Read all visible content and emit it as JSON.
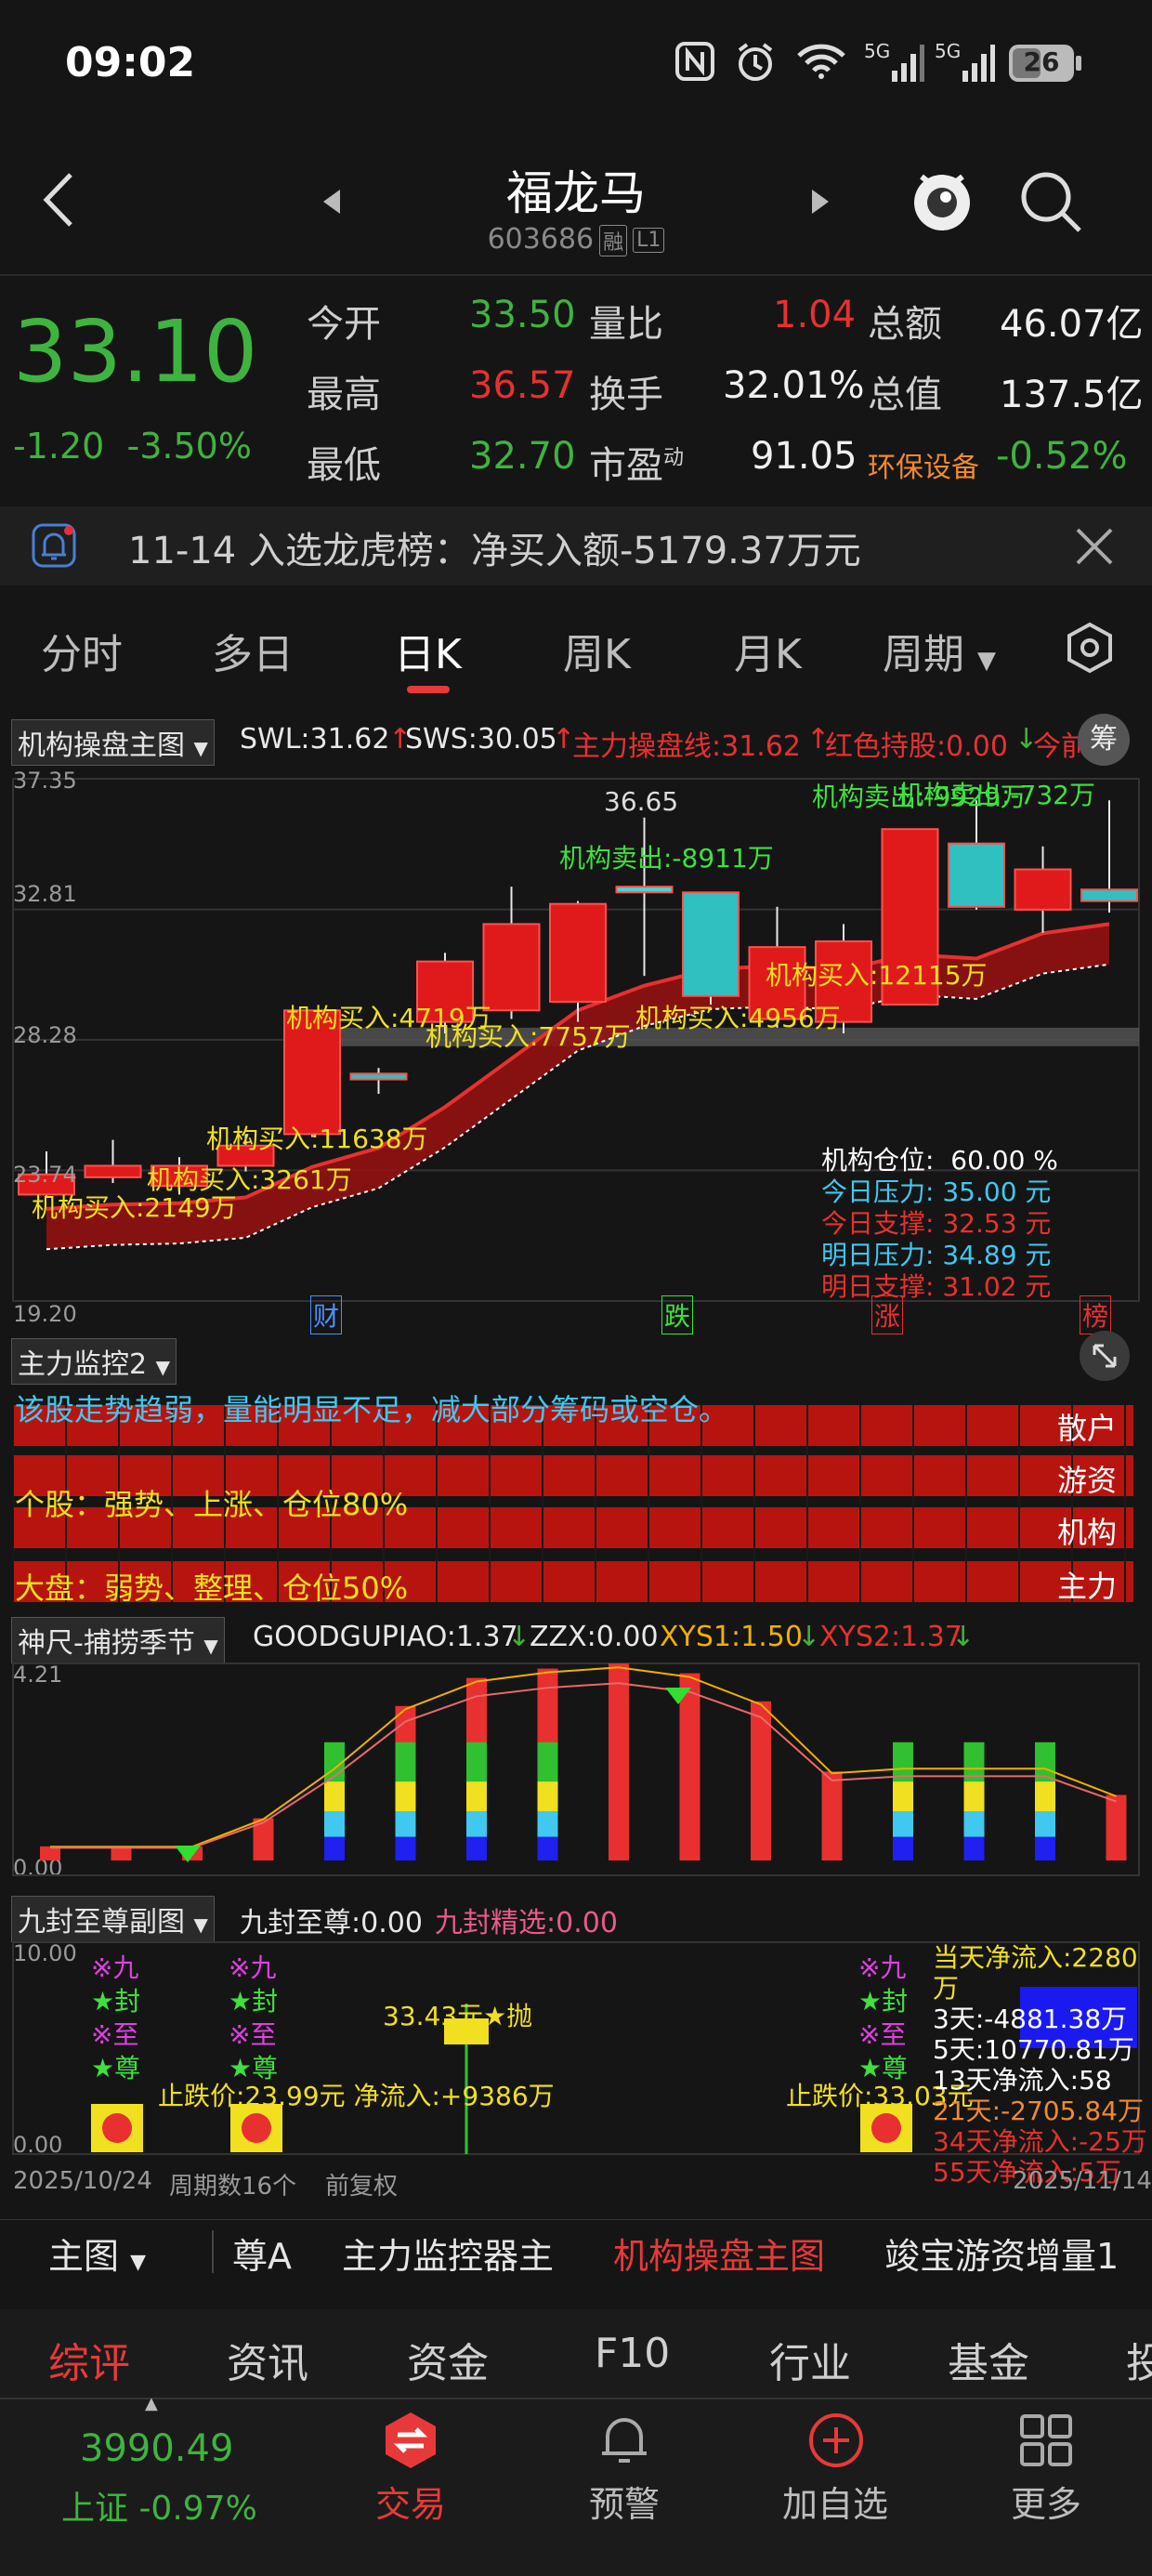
{
  "status_bar": {
    "time": "09:02",
    "battery": "26"
  },
  "header": {
    "name": "福龙马",
    "code": "603686",
    "tag1": "融",
    "tag2": "L1"
  },
  "quote": {
    "price": "33.10",
    "change": "-1.20",
    "change_pct": "-3.50%",
    "open_label": "今开",
    "open": "33.50",
    "high_label": "最高",
    "high": "36.57",
    "low_label": "最低",
    "low": "32.70",
    "vol_ratio_label": "量比",
    "vol_ratio": "1.04",
    "turnover_label": "换手",
    "turnover": "32.01%",
    "pe_label": "市盈",
    "pe_sup": "动",
    "pe": "91.05",
    "amount_label": "总额",
    "amount": "46.07亿",
    "mcap_label": "总值",
    "mcap": "137.5亿",
    "sector": "环保设备",
    "sector_pct": "-0.52%",
    "colors": {
      "up": "#e83030",
      "down": "#3fb33f"
    }
  },
  "notice": {
    "text": "11-14 入选龙虎榜：净买入额-5179.37万元"
  },
  "tabs": [
    "分时",
    "多日",
    "日K",
    "周K",
    "月K",
    "周期"
  ],
  "main_chart": {
    "label": "机构操盘主图",
    "ind1": "SWL:31.62",
    "ind2": "SWS:30.05",
    "ind3": "主力操盘线:31.62",
    "ind4": "红色持股:0.00",
    "ind5": "今前",
    "chip_btn": "筹",
    "y_labels": [
      "37.35",
      "32.81",
      "28.28",
      "23.74",
      "19.20"
    ],
    "high_label": "36.65",
    "annotations": [
      "机构卖出:-8911万",
      "机构卖出:-9929万",
      "机构卖出:-732万",
      "机构买入:4719万",
      "机构买入:7757万",
      "机构买入:4956万",
      "机构买入:12115万",
      "机构买入:11638万",
      "机构买入:3261万",
      "机构买入:2149万"
    ],
    "info": {
      "pos_label": "机构仓位:",
      "pos": "60.00 %",
      "press1_label": "今日压力:",
      "press1": "35.00 元",
      "supp1_label": "今日支撑:",
      "supp1": "32.53 元",
      "press2_label": "明日压力:",
      "press2": "34.89 元",
      "supp2_label": "明日支撑:",
      "supp2": "31.02 元"
    },
    "markers": [
      "财",
      "跌",
      "涨",
      "榜"
    ]
  },
  "chart_data": {
    "type": "candlestick",
    "ylim": [
      19.2,
      37.35
    ],
    "candles": [
      {
        "o": 22.9,
        "c": 23.6,
        "h": 24.4,
        "l": 22.8
      },
      {
        "o": 23.5,
        "c": 23.9,
        "h": 24.8,
        "l": 23.3
      },
      {
        "o": 23.2,
        "c": 23.9,
        "h": 24.2,
        "l": 22.9
      },
      {
        "o": 23.9,
        "c": 24.6,
        "h": 25.0,
        "l": 23.7
      },
      {
        "o": 25.0,
        "c": 29.3,
        "h": 29.3,
        "l": 24.9
      },
      {
        "o": 27.1,
        "c": 26.9,
        "h": 27.3,
        "l": 26.4
      },
      {
        "o": 28.9,
        "c": 31.0,
        "h": 31.3,
        "l": 28.5
      },
      {
        "o": 29.3,
        "c": 32.3,
        "h": 33.6,
        "l": 29.0
      },
      {
        "o": 29.6,
        "c": 33.0,
        "h": 33.1,
        "l": 28.9
      },
      {
        "o": 33.4,
        "c": 33.6,
        "h": 36.0,
        "l": 30.5
      },
      {
        "o": 33.4,
        "c": 29.8,
        "h": 33.4,
        "l": 29.5
      },
      {
        "o": 29.0,
        "c": 31.5,
        "h": 32.9,
        "l": 28.7
      },
      {
        "o": 28.9,
        "c": 31.7,
        "h": 32.3,
        "l": 28.5
      },
      {
        "o": 29.5,
        "c": 35.6,
        "h": 35.6,
        "l": 29.5
      },
      {
        "o": 35.1,
        "c": 32.9,
        "h": 36.6,
        "l": 32.8
      },
      {
        "o": 32.8,
        "c": 34.2,
        "h": 35.0,
        "l": 32.0
      },
      {
        "o": 33.5,
        "c": 33.1,
        "h": 36.6,
        "l": 32.7
      }
    ]
  },
  "monitor": {
    "label": "主力监控2",
    "msg": "该股走势趋弱，量能明显不足，减大部分筹码或空仓。",
    "stock": "个股：强势、上涨、仓位80%",
    "market": "大盘：弱势、整理、仓位50%",
    "rows": [
      "散户",
      "游资",
      "机构",
      "主力"
    ]
  },
  "sub1": {
    "label": "神尺-捕捞季节",
    "ind1": "GOODGUPIAO:1.37",
    "ind2": "ZZX:0.00",
    "ind3": "XYS1:1.50",
    "ind4": "XYS2:1.37",
    "ymax": "4.21",
    "ymin": "0.00"
  },
  "sub2": {
    "label": "九封至尊副图",
    "ind1": "九封至尊:0.00",
    "ind2": "九封精选:0.00",
    "ymax": "10.00",
    "ymin": "0.00",
    "stop1": "止跌价:23.99元 净流入:+9386万",
    "stop2": "止跌价:33.03元",
    "sell": "33.43元★抛",
    "flows": [
      "当天净流入:2280万",
      "3天:-4881.38万",
      "5天:10770.81万",
      "13天净流入:58",
      "21天:-2705.84万",
      "34天净流入:-25万",
      "55天净流入:5万"
    ],
    "stars": [
      "※九",
      "★封",
      "※至",
      "★尊"
    ],
    "date_start": "2025/10/24",
    "period": "周期数16个",
    "adj": "前复权",
    "date_end": "2025/11/14"
  },
  "bottom_bar": {
    "main": "主图",
    "items": [
      "尊A",
      "主力监控器主",
      "机构操盘主图",
      "竣宝游资增量1"
    ]
  },
  "categories": [
    "综评",
    "资讯",
    "资金",
    "F10",
    "行业",
    "基金",
    "投"
  ],
  "dock": {
    "index_value": "3990.49",
    "index_label": "上证 -0.97%",
    "trade": "交易",
    "alert": "预警",
    "add": "加自选",
    "more": "更多"
  }
}
